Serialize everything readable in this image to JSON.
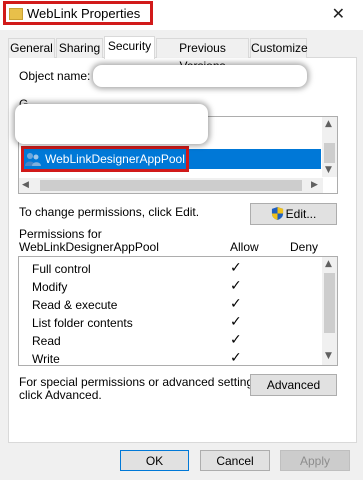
{
  "window": {
    "title": "WebLink Properties",
    "close_glyph": "✕"
  },
  "tabs": [
    {
      "label": "General"
    },
    {
      "label": "Sharing"
    },
    {
      "label": "Security"
    },
    {
      "label": "Previous Versions"
    },
    {
      "label": "Customize"
    }
  ],
  "security": {
    "object_name_label": "Object name:",
    "group_label_partial": "G",
    "selected_group": "WebLinkDesignerAppPool",
    "change_permissions_text": "To change permissions, click Edit.",
    "edit_button": "Edit...",
    "permissions_for_label": "Permissions for",
    "permissions_for_name": "WebLinkDesignerAppPool",
    "allow_header": "Allow",
    "deny_header": "Deny",
    "permissions": [
      {
        "name": "Full control",
        "allow": true,
        "deny": false
      },
      {
        "name": "Modify",
        "allow": true,
        "deny": false
      },
      {
        "name": "Read & execute",
        "allow": true,
        "deny": false
      },
      {
        "name": "List folder contents",
        "allow": true,
        "deny": false
      },
      {
        "name": "Read",
        "allow": true,
        "deny": false
      },
      {
        "name": "Write",
        "allow": true,
        "deny": false
      }
    ],
    "check_glyph": "✓",
    "advanced_text_line1": "For special permissions or advanced settings,",
    "advanced_text_line2": "click Advanced.",
    "advanced_button": "Advanced"
  },
  "footer": {
    "ok": "OK",
    "cancel": "Cancel",
    "apply": "Apply"
  },
  "colors": {
    "selection": "#0078d7",
    "highlight_box": "#d11a1a"
  }
}
